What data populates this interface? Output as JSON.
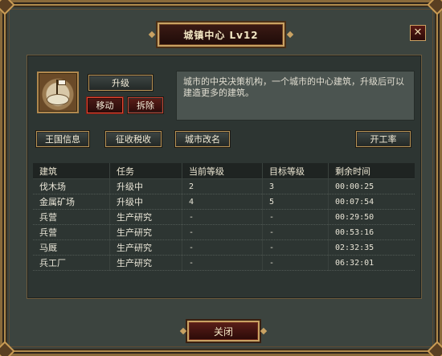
{
  "window": {
    "title": "城镇中心 Lv12",
    "close_glyph": "✕"
  },
  "building": {
    "icon": "town-hall-icon",
    "description": "城市的中央决策机构，一个城市的中心建筑，升级后可以建造更多的建筑。"
  },
  "actions": {
    "upgrade": "升级",
    "move": "移动",
    "demolish": "拆除"
  },
  "toolbar": {
    "kingdom_info": "王国信息",
    "tax": "征收税收",
    "rename_city": "城市改名",
    "work_rate": "开工率"
  },
  "table": {
    "headers": [
      "建筑",
      "任务",
      "当前等级",
      "目标等级",
      "剩余时间"
    ],
    "rows": [
      [
        "伐木场",
        "升级中",
        "2",
        "3",
        "00:00:25"
      ],
      [
        "金属矿场",
        "升级中",
        "4",
        "5",
        "00:07:54"
      ],
      [
        "兵营",
        "生产研究",
        "-",
        "-",
        "00:29:50"
      ],
      [
        "兵营",
        "生产研究",
        "-",
        "-",
        "00:53:16"
      ],
      [
        "马厩",
        "生产研究",
        "-",
        "-",
        "02:32:35"
      ],
      [
        "兵工厂",
        "生产研究",
        "-",
        "-",
        "06:32:01"
      ]
    ]
  },
  "footer": {
    "close": "关闭"
  }
}
